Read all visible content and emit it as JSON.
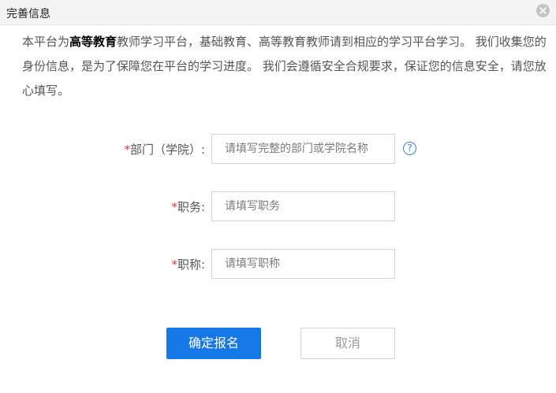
{
  "dialog": {
    "title": "完善信息",
    "close_icon": "close-icon"
  },
  "intro": {
    "before": "本平台为",
    "highlight": "高等教育",
    "after": "教师学习平台，基础教育、高等教育教师请到相应的学习平台学习。 我们收集您的身份信息，是为了保障您在平台的学习进度。 我们会遵循安全合规要求，保证您的信息安全，请您放心填写。"
  },
  "form": {
    "required_mark": "*",
    "department": {
      "label": "部门（学院）:",
      "placeholder": "请填写完整的部门或学院名称",
      "value": "",
      "help_icon": "help-icon",
      "help_glyph": "?"
    },
    "duty": {
      "label": "职务:",
      "placeholder": "请填写职务",
      "value": ""
    },
    "title": {
      "label": "职称:",
      "placeholder": "请填写职称",
      "value": ""
    }
  },
  "actions": {
    "confirm_label": "确定报名",
    "cancel_label": "取消"
  },
  "colors": {
    "primary": "#1677e6",
    "required": "#e53935",
    "help": "#3a7fd5"
  }
}
